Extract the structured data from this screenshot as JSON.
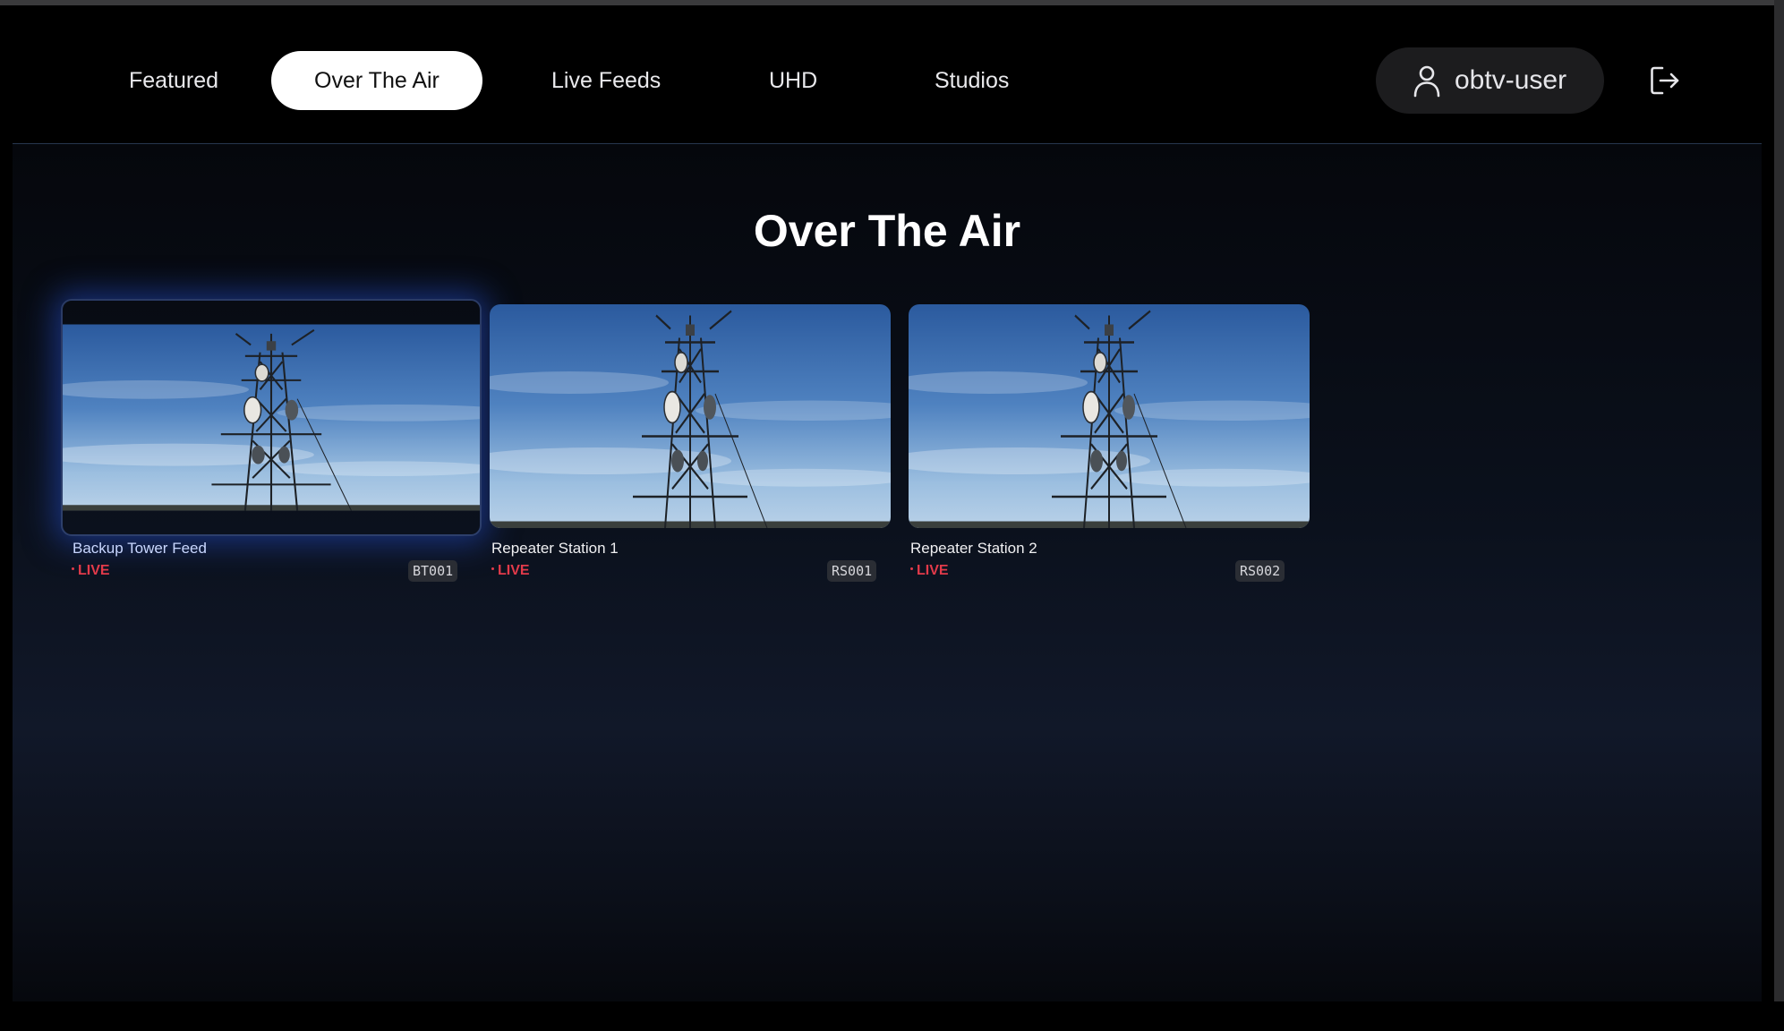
{
  "nav": {
    "tabs": [
      {
        "label": "Featured",
        "active": false
      },
      {
        "label": "Over The Air",
        "active": true
      },
      {
        "label": "Live Feeds",
        "active": false
      },
      {
        "label": "UHD",
        "active": false
      },
      {
        "label": "Studios",
        "active": false
      }
    ],
    "user": {
      "name": "obtv-user",
      "icon": "user-icon"
    },
    "logout_icon": "logout-icon"
  },
  "main": {
    "title": "Over The Air",
    "cards": [
      {
        "title": "Backup Tower Feed",
        "status": "LIVE",
        "code": "BT001",
        "focused": true
      },
      {
        "title": "Repeater Station 1",
        "status": "LIVE",
        "code": "RS001",
        "focused": false
      },
      {
        "title": "Repeater Station 2",
        "status": "LIVE",
        "code": "RS002",
        "focused": false
      }
    ]
  },
  "colors": {
    "live": "#e23a4a",
    "active_tab_bg": "#ffffff",
    "focus_glow": "#244cc8"
  }
}
